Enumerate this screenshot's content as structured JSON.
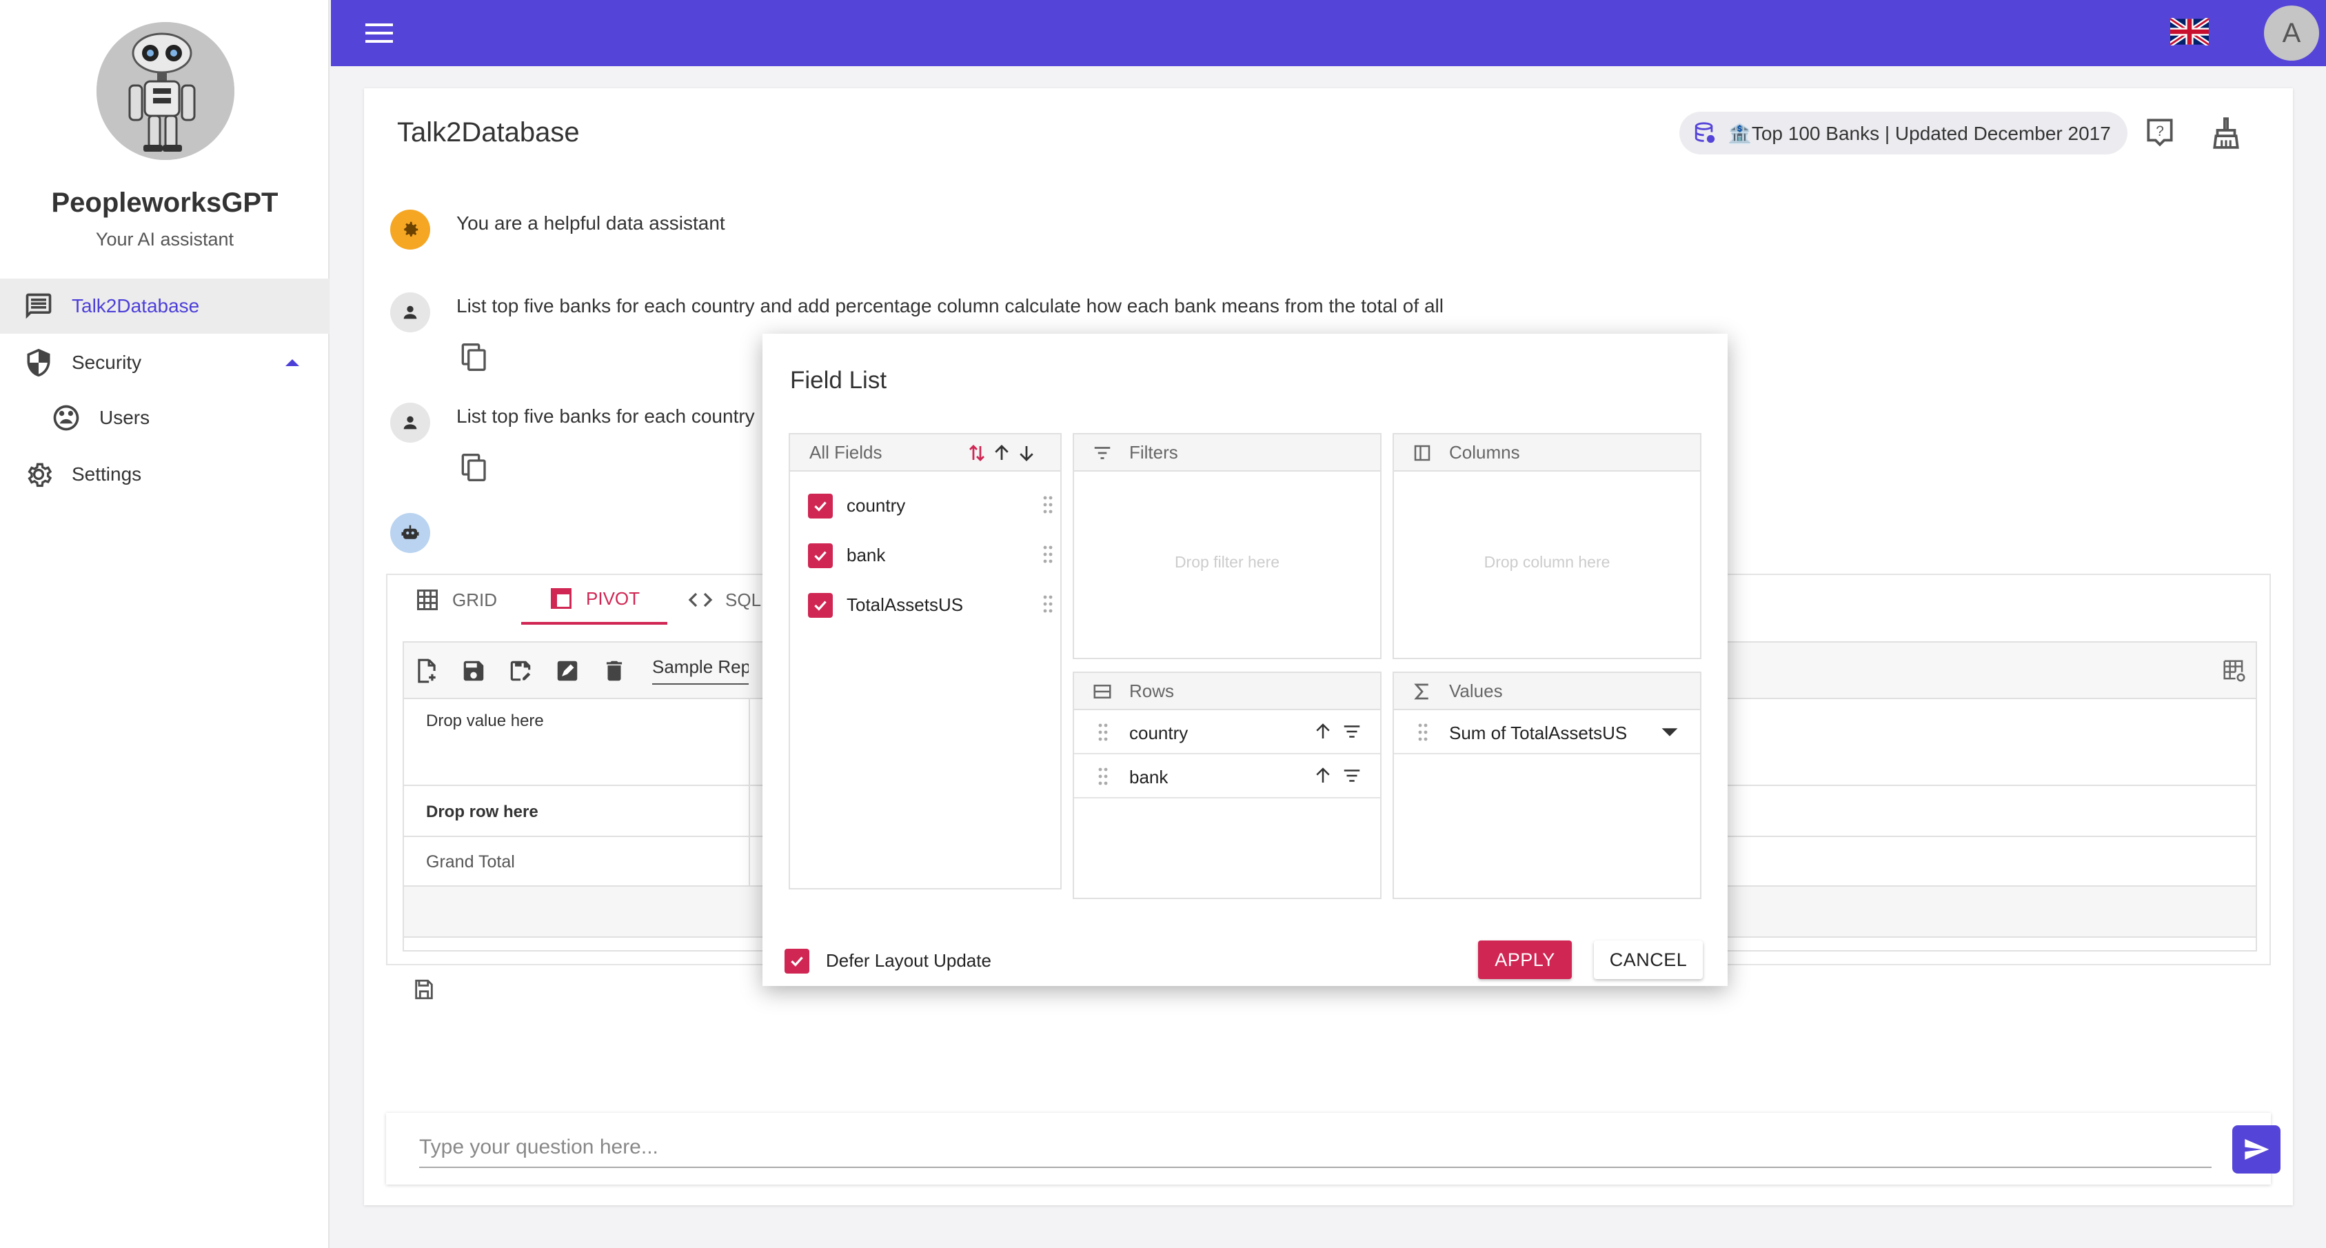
{
  "sidebar": {
    "app_name": "PeopleworksGPT",
    "tagline": "Your AI assistant",
    "items": [
      {
        "label": "Talk2Database",
        "icon": "chat-icon",
        "active": true
      },
      {
        "label": "Security",
        "icon": "shield-icon",
        "expanded": true
      },
      {
        "label": "Users",
        "icon": "users-icon"
      },
      {
        "label": "Settings",
        "icon": "gear-icon"
      }
    ]
  },
  "topbar": {
    "menu_icon": "menu-icon",
    "language_icon": "uk-flag-icon",
    "user_initial": "A"
  },
  "main": {
    "title": "Talk2Database",
    "database_chip": "🏦Top 100 Banks | Updated December 2017",
    "messages": [
      {
        "role": "system",
        "text": "You are a helpful data assistant"
      },
      {
        "role": "user",
        "text": "List top five banks for each country and add percentage column calculate how each bank means from the total of all"
      },
      {
        "role": "user",
        "text": "List top five banks for each country"
      },
      {
        "role": "bot",
        "text": ""
      }
    ],
    "tabs": [
      {
        "label": "GRID",
        "icon": "grid-icon"
      },
      {
        "label": "PIVOT",
        "icon": "pivot-icon",
        "active": true
      },
      {
        "label": "SQL",
        "icon": "code-icon"
      }
    ],
    "pivot": {
      "report_name": "Sample Report",
      "drop_value": "Drop value here",
      "drop_row": "Drop row here",
      "grand_total": "Grand Total"
    },
    "input_placeholder": "Type your question here..."
  },
  "field_list": {
    "title": "Field List",
    "all_fields_label": "All Fields",
    "fields": [
      {
        "label": "country",
        "checked": true
      },
      {
        "label": "bank",
        "checked": true
      },
      {
        "label": "TotalAssetsUS",
        "checked": true
      }
    ],
    "filters": {
      "label": "Filters",
      "placeholder": "Drop filter here"
    },
    "columns": {
      "label": "Columns",
      "placeholder": "Drop column here"
    },
    "rows": {
      "label": "Rows",
      "items": [
        "country",
        "bank"
      ]
    },
    "values": {
      "label": "Values",
      "items": [
        "Sum of TotalAssetsUS"
      ]
    },
    "defer_label": "Defer Layout Update",
    "defer_checked": true,
    "apply_label": "APPLY",
    "cancel_label": "CANCEL"
  },
  "colors": {
    "primary": "#5544d8",
    "accent": "#d02653",
    "system_icon_bg": "#f5a623",
    "bot_icon_bg": "#b9d3f0"
  }
}
